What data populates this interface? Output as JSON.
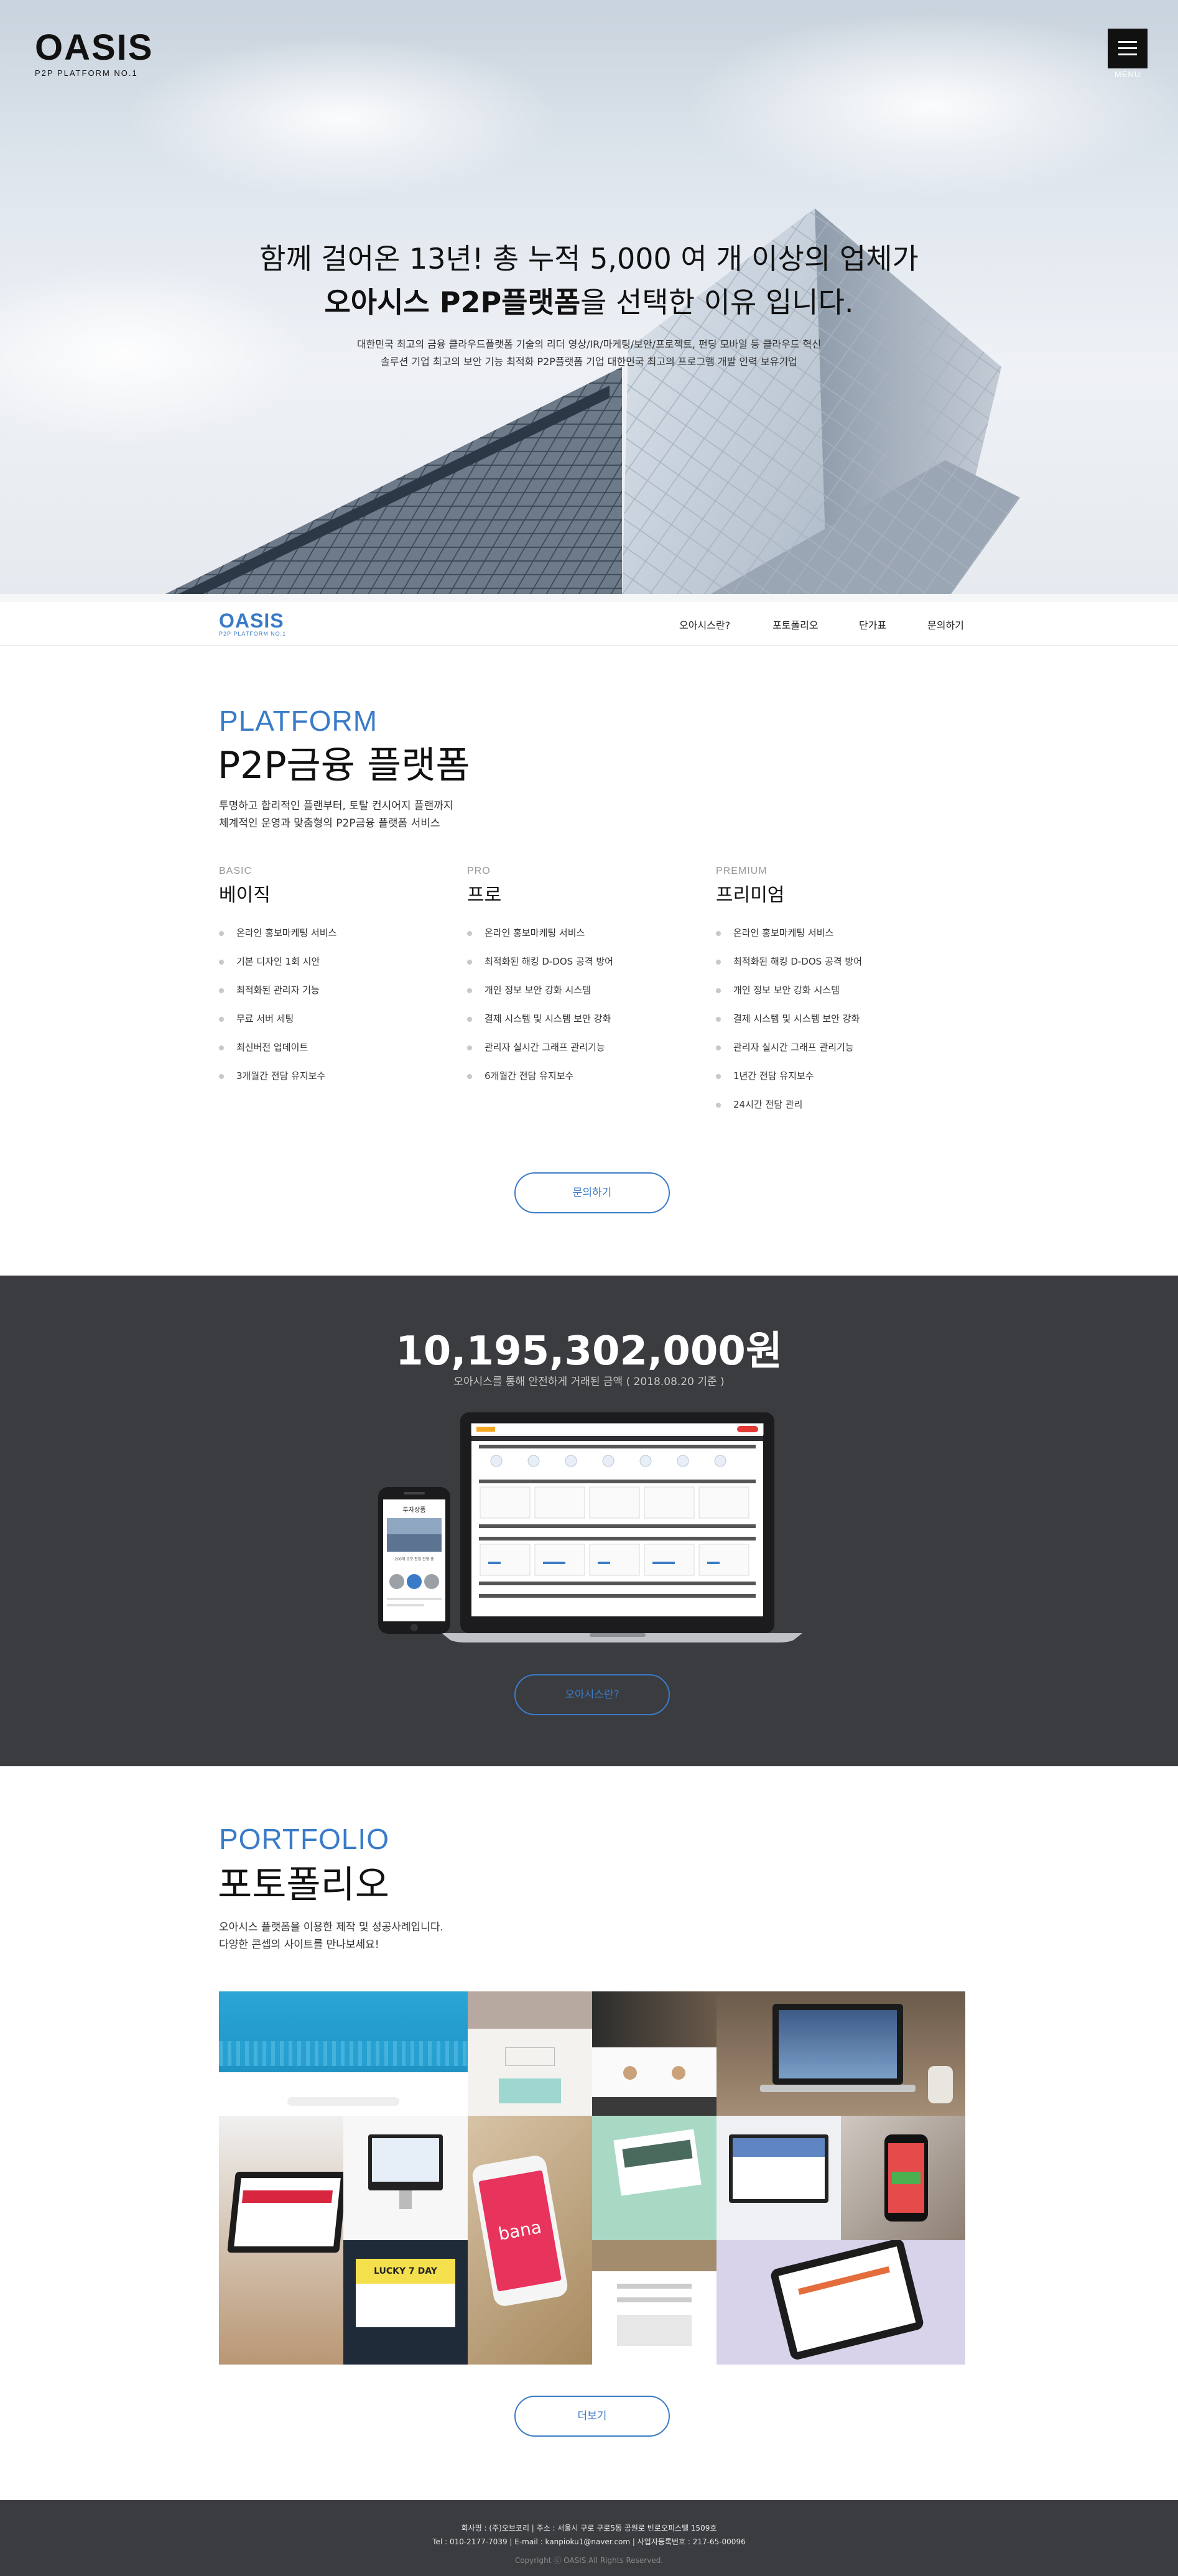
{
  "hero": {
    "logo_word": "OASIS",
    "logo_sub": "P2P PLATFORM NO.1",
    "menu_label": "MENU",
    "title_line1": "함께 걸어온 13년! 총 누적 5,000 여 개 이상의 업체가",
    "title_line2_bold": "오아시스 P2P플랫폼",
    "title_line2_rest": "을 선택한 이유 입니다.",
    "desc_line1": "대한민국 최고의 금융 클라우드플랫폼 기술의 리더 영상/IR/마케팅/보안/프로젝트, 펀딩 모바일 등 클라우드 혁신",
    "desc_line2": "솔루션 기업 최고의 보안 기능 최적화 P2P플랫폼 기업 대한민국 최고의 프로그램 개발 인력 보유기업"
  },
  "nav": {
    "logo_word": "OASIS",
    "logo_sub": "P2P PLATFORM NO.1",
    "items": [
      "오아시스란?",
      "포토폴리오",
      "단가표",
      "문의하기"
    ]
  },
  "platform": {
    "eng": "PLATFORM",
    "kor": "P2P금융 플랫폼",
    "desc_line1": "투명하고 합리적인 플랜부터, 토탈 컨시어지 플랜까지",
    "desc_line2": "체계적인 운영과 맞춤형의 P2P금융 플랫폼 서비스",
    "plans": [
      {
        "en": "BASIC",
        "ko": "베이직",
        "items": [
          "온라인 홍보마케팅 서비스",
          "기본 디자인 1회 시안",
          "최적화된 관리자 기능",
          "무료 서버 세팅",
          "최신버전 업데이트",
          "3개월간 전담 유지보수"
        ]
      },
      {
        "en": "PRO",
        "ko": "프로",
        "items": [
          "온라인 홍보마케팅 서비스",
          "최적화된 해킹 D-DOS 공격 방어",
          "개인 정보 보안 강화 시스템",
          "결제 시스템 및 시스템 보안 강화",
          "관리자 실시간 그래프 관리기능",
          "6개월간 전담 유지보수"
        ]
      },
      {
        "en": "PREMIUM",
        "ko": "프리미엄",
        "items": [
          "온라인 홍보마케팅 서비스",
          "최적화된 해킹 D-DOS 공격 방어",
          "개인 정보 보안 강화 시스템",
          "결제 시스템 및 시스템 보안 강화",
          "관리자 실시간 그래프 관리기능",
          "1년간 전담 유지보수",
          "24시간 전담 관리"
        ]
      }
    ],
    "button": "문의하기"
  },
  "stats": {
    "amount": "10,195,302,000원",
    "sub": "오아시스를 통해 안전하게 거래된 금액 ( 2018.08.20 기준 )",
    "button": "오아시스란?",
    "phone_title": "투자상품",
    "phone_caption": "200억 규모 펀딩 진행 중"
  },
  "portfolio": {
    "eng": "PORTFOLIO",
    "kor": "포토폴리오",
    "desc_line1": "오아시스 플랫폼을 이용한 제작 및 성공사례입니다.",
    "desc_line2": "다양한 콘셉의 사이트를 만나보세요!",
    "tile_texts": [
      "LUCKY 7 DAY",
      "bana"
    ],
    "button": "더보기"
  },
  "footer": {
    "line1": "회사명 : (주)오브코리 | 주소 : 서울시 구로 구로5동 공원로 빈로오피스텔 1509호",
    "line2": "Tel : 010-2177-7039 | E-mail : kanpioku1@naver.com | 사업자등록번호 : 217-65-00096",
    "copyright": "Copyright ⓒ OASIS All Rights Reserved."
  },
  "colors": {
    "accent": "#3a7bc8",
    "dark_bg": "#3b3c40",
    "text": "#111111"
  }
}
